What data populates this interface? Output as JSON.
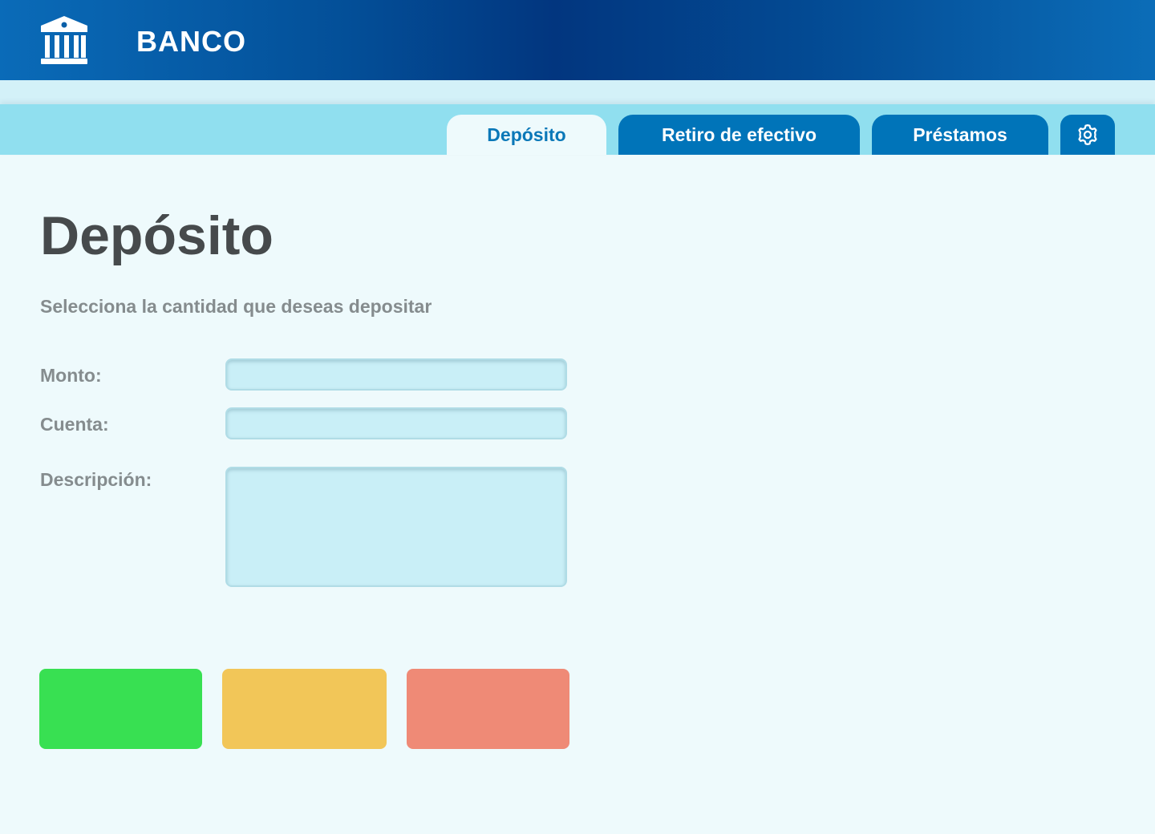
{
  "header": {
    "brand": "BANCO",
    "logo_icon": "bank-icon"
  },
  "tabs": [
    {
      "label": "Depósito",
      "active": true
    },
    {
      "label": "Retiro de efectivo",
      "active": false
    },
    {
      "label": "Préstamos",
      "active": false
    }
  ],
  "settings_icon": "gear-icon",
  "main": {
    "title": "Depósito",
    "subtitle": "Selecciona la cantidad que deseas depositar",
    "fields": {
      "monto_label": "Monto:",
      "monto_value": "",
      "cuenta_label": "Cuenta:",
      "cuenta_value": "",
      "descripcion_label": "Descripción:",
      "descripcion_value": ""
    },
    "buttons": {
      "green_label": "",
      "yellow_label": "",
      "red_label": ""
    }
  },
  "colors": {
    "header_dark": "#02367f",
    "tab_blue": "#0074b9",
    "tab_strip": "#8fdcee",
    "title_text": "#464a4c",
    "label_text": "#858c8e",
    "button_green": "#38e052",
    "button_yellow": "#f2c658",
    "button_red": "#ef8a76"
  }
}
